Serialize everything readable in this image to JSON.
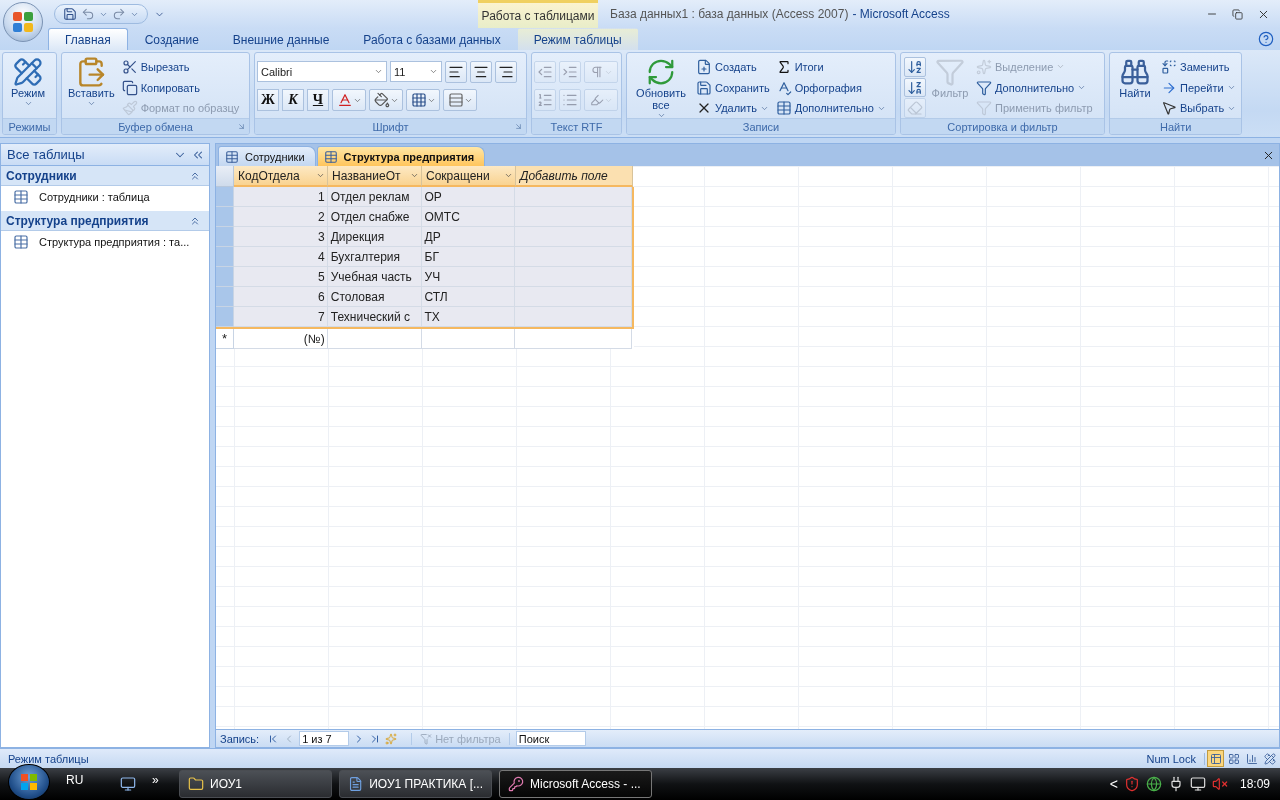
{
  "window": {
    "title": "База данных1 : база данных (Access 2007)",
    "app_name": "- Microsoft Access"
  },
  "contextual_group": "Работа с таблицами",
  "ribbon_tabs": [
    {
      "label": "Главная",
      "selected": true,
      "contextual": false
    },
    {
      "label": "Создание",
      "selected": false,
      "contextual": false
    },
    {
      "label": "Внешние данные",
      "selected": false,
      "contextual": false
    },
    {
      "label": "Работа с базами данных",
      "selected": false,
      "contextual": false
    },
    {
      "label": "Режим таблицы",
      "selected": false,
      "contextual": true
    }
  ],
  "ribbon_groups": [
    {
      "title": "Режимы",
      "kind": "stack",
      "launcher": false,
      "controls": [
        {
          "kind": "large",
          "label": "Режим",
          "dropdown": true,
          "disabled": false
        }
      ]
    },
    {
      "title": "Буфер обмена",
      "kind": "stack",
      "launcher": true,
      "controls": [
        {
          "kind": "large",
          "label": "Вставить",
          "dropdown": true,
          "disabled": false
        },
        {
          "kind": "small",
          "label": "Вырезать",
          "dropdown": false,
          "disabled": false
        },
        {
          "kind": "small",
          "label": "Копировать",
          "dropdown": false,
          "disabled": false
        },
        {
          "kind": "small",
          "label": "Формат по образцу",
          "dropdown": false,
          "disabled": true
        }
      ]
    },
    {
      "title": "Шрифт",
      "kind": "grid",
      "launcher": true,
      "controls": [
        {
          "kind": "combo",
          "label": "Calibri",
          "dropdown": true,
          "disabled": false
        },
        {
          "kind": "combo",
          "label": "11",
          "dropdown": true,
          "disabled": false
        },
        {
          "kind": "icon",
          "dropdown": false,
          "disabled": false
        },
        {
          "kind": "icon",
          "dropdown": false,
          "disabled": false
        },
        {
          "kind": "icon",
          "dropdown": false,
          "disabled": false
        },
        {
          "kind": "char",
          "label": "Ж",
          "dropdown": false,
          "disabled": false
        },
        {
          "kind": "char",
          "label": "К",
          "dropdown": false,
          "disabled": false
        },
        {
          "kind": "char",
          "label": "Ч",
          "dropdown": false,
          "disabled": false
        },
        {
          "kind": "icon",
          "dropdown": true,
          "disabled": false
        },
        {
          "kind": "icon",
          "dropdown": true,
          "disabled": false
        },
        {
          "kind": "icon",
          "dropdown": true,
          "disabled": false
        },
        {
          "kind": "icon",
          "dropdown": true,
          "disabled": false
        }
      ]
    },
    {
      "title": "Текст RTF",
      "kind": "grid",
      "launcher": false,
      "controls": [
        {
          "kind": "icon",
          "dropdown": false,
          "disabled": true
        },
        {
          "kind": "icon",
          "dropdown": false,
          "disabled": true
        },
        {
          "kind": "icon",
          "dropdown": true,
          "disabled": true
        },
        {
          "kind": "icon",
          "dropdown": false,
          "disabled": true
        },
        {
          "kind": "icon",
          "dropdown": false,
          "disabled": true
        },
        {
          "kind": "icon",
          "dropdown": true,
          "disabled": true
        }
      ]
    },
    {
      "title": "Записи",
      "kind": "stack",
      "launcher": false,
      "controls": [
        {
          "kind": "large",
          "label": "Обновить все",
          "dropdown": true,
          "disabled": false
        },
        {
          "kind": "small",
          "label": "Создать",
          "dropdown": false,
          "disabled": false
        },
        {
          "kind": "small",
          "label": "Сохранить",
          "dropdown": false,
          "disabled": false
        },
        {
          "kind": "small",
          "label": "Удалить",
          "dropdown": true,
          "disabled": false
        },
        {
          "kind": "small",
          "label": "Итоги",
          "dropdown": false,
          "disabled": false
        },
        {
          "kind": "small",
          "label": "Орфография",
          "dropdown": false,
          "disabled": false
        },
        {
          "kind": "small",
          "label": "Дополнительно",
          "dropdown": true,
          "disabled": false
        }
      ]
    },
    {
      "title": "Сортировка и фильтр",
      "kind": "stack",
      "launcher": false,
      "controls": [
        {
          "kind": "icon",
          "dropdown": false,
          "disabled": false
        },
        {
          "kind": "icon",
          "dropdown": false,
          "disabled": false
        },
        {
          "kind": "icon",
          "dropdown": false,
          "disabled": true
        },
        {
          "kind": "large",
          "label": "Фильтр",
          "dropdown": false,
          "disabled": true
        },
        {
          "kind": "small",
          "label": "Выделение",
          "dropdown": true,
          "disabled": true
        },
        {
          "kind": "small",
          "label": "Дополнительно",
          "dropdown": true,
          "disabled": false
        },
        {
          "kind": "small",
          "label": "Применить фильтр",
          "dropdown": false,
          "disabled": true
        }
      ]
    },
    {
      "title": "Найти",
      "kind": "stack",
      "launcher": false,
      "controls": [
        {
          "kind": "large",
          "label": "Найти",
          "dropdown": false,
          "disabled": false
        },
        {
          "kind": "small",
          "label": "Заменить",
          "dropdown": false,
          "disabled": false
        },
        {
          "kind": "small",
          "label": "Перейти",
          "dropdown": true,
          "disabled": false
        },
        {
          "kind": "small",
          "label": "Выбрать",
          "dropdown": true,
          "disabled": false
        }
      ]
    }
  ],
  "nav_pane": {
    "title": "Все таблицы",
    "groups": [
      {
        "title": "Сотрудники",
        "expanded": true,
        "items": [
          "Сотрудники : таблица"
        ]
      },
      {
        "title": "Структура предприятия",
        "expanded": true,
        "items": [
          "Структура предприятия : та..."
        ]
      }
    ]
  },
  "document_tabs": [
    {
      "label": "Сотрудники",
      "selected": false
    },
    {
      "label": "Структура предприятия",
      "selected": true
    }
  ],
  "table": {
    "columns": [
      {
        "label": "КодОтдела",
        "kind": "field"
      },
      {
        "label": "НазваниеОт",
        "kind": "field"
      },
      {
        "label": "Сокращени",
        "kind": "field"
      },
      {
        "label": "Добавить поле",
        "kind": "add"
      }
    ],
    "rows": [
      {
        "selected": true,
        "cells": [
          "1",
          "Отдел реклам",
          "ОР"
        ]
      },
      {
        "selected": true,
        "cells": [
          "2",
          "Отдел снабже",
          "ОМТС"
        ]
      },
      {
        "selected": true,
        "cells": [
          "3",
          "Дирекция",
          "ДР"
        ]
      },
      {
        "selected": true,
        "cells": [
          "4",
          "Бухгалтерия",
          "БГ"
        ]
      },
      {
        "selected": true,
        "cells": [
          "5",
          "Учебная часть",
          "УЧ"
        ]
      },
      {
        "selected": true,
        "cells": [
          "6",
          "Столовая",
          "СТЛ"
        ]
      },
      {
        "selected": true,
        "cells": [
          "7",
          "Технический с",
          "ТХ"
        ]
      }
    ],
    "new_row": {
      "marker": "*",
      "value": "(№)"
    }
  },
  "record_nav": {
    "label": "Запись:",
    "position": "1 из 7",
    "filter": "Нет фильтра",
    "search_placeholder": "Поиск"
  },
  "status_bar": {
    "mode": "Режим таблицы",
    "num_lock": "Num Lock",
    "views": [
      {
        "selected": true
      },
      {
        "selected": false
      },
      {
        "selected": false
      },
      {
        "selected": false
      }
    ]
  },
  "taskbar": {
    "language": "RU",
    "more": "»",
    "tasks": [
      {
        "label": "ИОУ1",
        "selected": false
      },
      {
        "label": "ИОУ1 ПРАКТИКА [...",
        "selected": false
      },
      {
        "label": "Microsoft Access - ...",
        "selected": true
      }
    ],
    "tray_expand": "<",
    "clock": "18:09"
  }
}
